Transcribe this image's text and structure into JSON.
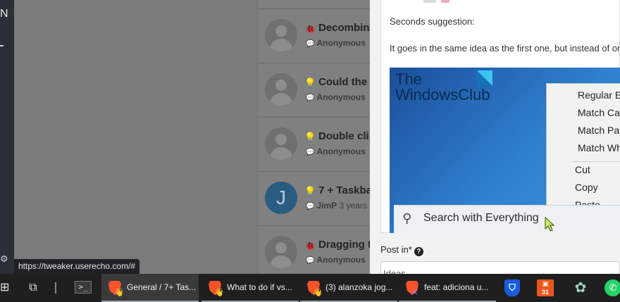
{
  "tooltip": {
    "url": "https://tweaker.userecho.com/#"
  },
  "topics": [
    {
      "icon": "bug-icon",
      "glyph": "🐞",
      "title": "Decombin",
      "author": "Anonymous",
      "time": "",
      "avatar": "default"
    },
    {
      "icon": "bulb-icon",
      "glyph": "💡",
      "title": "Could the",
      "author": "Anonymous",
      "time": "",
      "avatar": "default"
    },
    {
      "icon": "bulb-icon",
      "glyph": "💡",
      "title": "Double cli",
      "author": "Anonymous",
      "time": "",
      "avatar": "default"
    },
    {
      "icon": "bulb-icon",
      "glyph": "💡",
      "title": "7 + Taskba",
      "author": "JimP",
      "time": "3 years",
      "avatar": "J"
    },
    {
      "icon": "bug-icon",
      "glyph": "🐞",
      "title": "Dragging t",
      "author": "Anonymous",
      "time": "",
      "avatar": "default"
    }
  ],
  "modal": {
    "heading": "Seconds suggestion:",
    "paragraph": "It goes in the same idea as the first one, but instead of or",
    "embedded_image": {
      "brand_line1": "The",
      "brand_line2": "WindowsClub",
      "menu_items": [
        "Regular Ex",
        "Match Cas",
        "Match Pat",
        "Match Wh",
        "Cut",
        "Copy",
        "Paste"
      ],
      "search_text": "Search with Everything"
    },
    "post_in_label": "Post in*",
    "post_in_value": "Ideas"
  },
  "taskbar": {
    "tasks": [
      {
        "label": "General / 7+ Tas...",
        "active": true
      },
      {
        "label": "What to do if vs...",
        "active": false
      },
      {
        "label": "(3) alanzoka jog...",
        "active": false
      },
      {
        "label": "feat: adiciona u...",
        "active": false
      }
    ],
    "orange_app_badge": "31"
  }
}
